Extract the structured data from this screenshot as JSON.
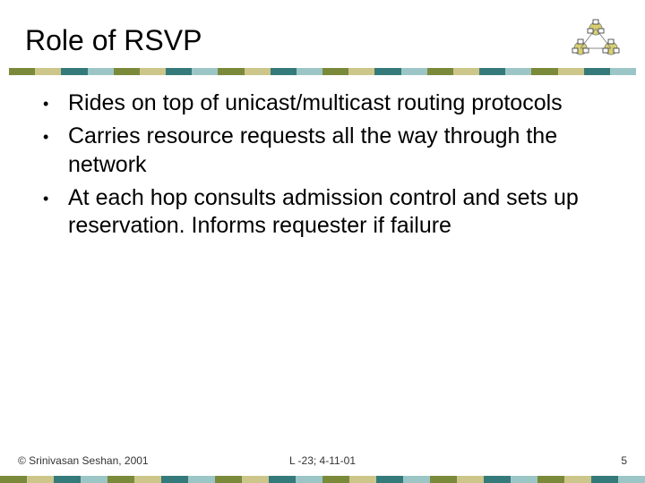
{
  "title": "Role of RSVP",
  "bullets": [
    "Rides on top of unicast/multicast routing protocols",
    "Carries resource requests all the way through the network",
    "At each hop consults admission control and sets up reservation. Informs requester if failure"
  ],
  "footer": {
    "left": "© Srinivasan Seshan, 2001",
    "center": "L -23; 4-11-01",
    "right": "5"
  },
  "stripe_classes": [
    "c1",
    "c2",
    "c3",
    "c4",
    "c1",
    "c2",
    "c3",
    "c4",
    "c1",
    "c2",
    "c3",
    "c4",
    "c1",
    "c2",
    "c3",
    "c4",
    "c1",
    "c2",
    "c3",
    "c4",
    "c1",
    "c2",
    "c3",
    "c4"
  ]
}
